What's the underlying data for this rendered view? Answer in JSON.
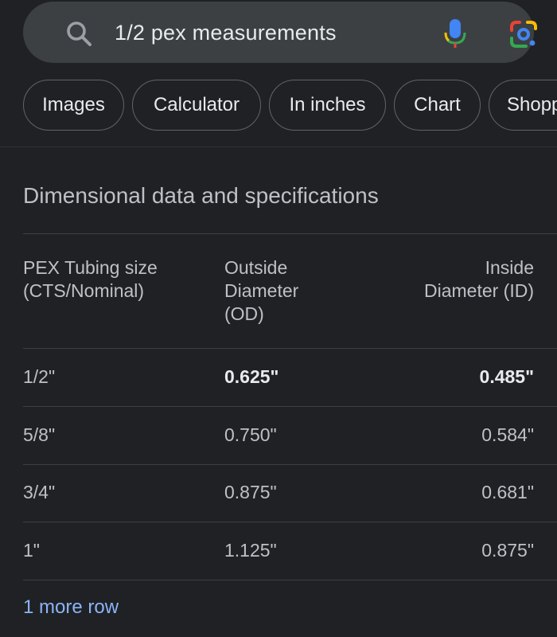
{
  "search": {
    "query": "1/2 pex measurements"
  },
  "icons": {
    "search": "search-icon",
    "voice": "microphone-icon",
    "lens": "google-lens-icon"
  },
  "chips": [
    {
      "label": "Images"
    },
    {
      "label": "Calculator"
    },
    {
      "label": "In inches"
    },
    {
      "label": "Chart"
    },
    {
      "label": "Shopping"
    }
  ],
  "section": {
    "title": "Dimensional data and specifications"
  },
  "table": {
    "headers": [
      [
        "PEX Tubing size",
        "(CTS/Nominal)"
      ],
      [
        "Outside",
        "Diameter",
        "(OD)"
      ],
      [
        "Inside",
        "Diameter (ID)"
      ]
    ],
    "rows": [
      {
        "size": "1/2\"",
        "od": "0.625\"",
        "id": "0.485\"",
        "highlight": true
      },
      {
        "size": "5/8\"",
        "od": "0.750\"",
        "id": "0.584\"",
        "highlight": false
      },
      {
        "size": "3/4\"",
        "od": "0.875\"",
        "id": "0.681\"",
        "highlight": false
      },
      {
        "size": "1\"",
        "od": "1.125\"",
        "id": "0.875\"",
        "highlight": false
      }
    ]
  },
  "more_link": "1 more row",
  "colors": {
    "background": "#202124",
    "search_bar": "#3c4043",
    "link": "#8ab4f8",
    "mic_blue": "#4285f4",
    "mic_red": "#ea4335",
    "mic_yellow": "#fbbc04",
    "mic_green": "#34a853"
  }
}
